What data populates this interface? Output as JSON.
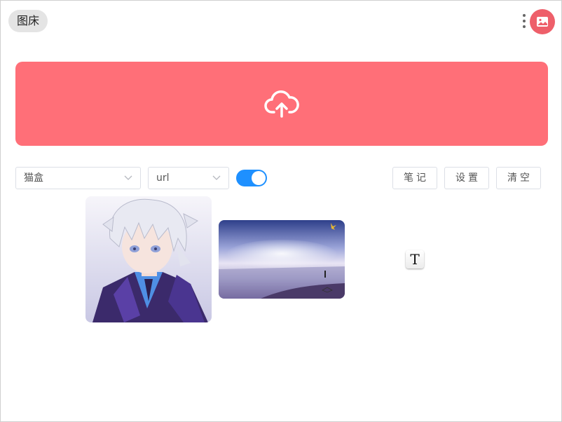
{
  "app": {
    "title": "图床"
  },
  "header": {
    "more_icon": "more-vertical-icon",
    "avatar_icon": "image-icon",
    "avatar_color": "#ee5f6a"
  },
  "upload": {
    "icon": "cloud-upload-icon",
    "background": "#ff6f78"
  },
  "controls": {
    "service_select": {
      "value": "猫盒"
    },
    "format_select": {
      "value": "url"
    },
    "toggle": {
      "on": true,
      "color": "#1e90ff"
    },
    "buttons": {
      "notes": "笔记",
      "settings": "设置",
      "clear": "清空"
    }
  },
  "gallery": {
    "items": [
      {
        "kind": "image",
        "subject": "anime-avatar"
      },
      {
        "kind": "image",
        "subject": "beach-sunset"
      },
      {
        "kind": "text-file",
        "glyph": "T"
      }
    ]
  }
}
